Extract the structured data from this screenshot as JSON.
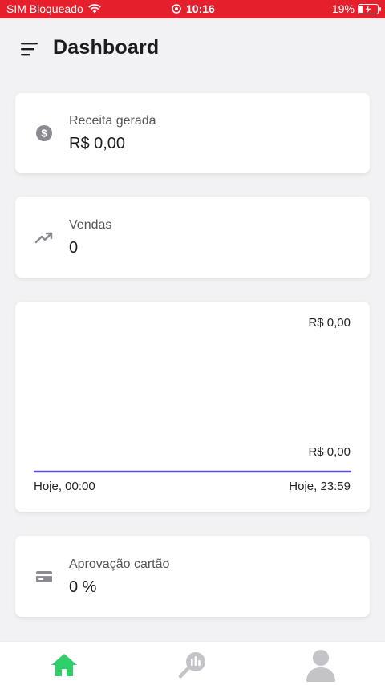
{
  "status_bar": {
    "carrier": "SIM Bloqueado",
    "time": "10:16",
    "battery": "19%",
    "battery_level": 0.19,
    "color": "#e5202c"
  },
  "header": {
    "title": "Dashboard",
    "menu_icon": "menu-icon"
  },
  "metrics": {
    "revenue": {
      "label": "Receita gerada",
      "value": "R$ 0,00",
      "icon": "dollar-circle-icon"
    },
    "sales": {
      "label": "Vendas",
      "value": "0",
      "icon": "trending-up-icon"
    },
    "approval": {
      "label": "Aprovação cartão",
      "value": "0 %",
      "icon": "credit-card-icon"
    }
  },
  "chart_data": {
    "type": "line",
    "x": [
      "Hoje, 00:00",
      "Hoje, 23:59"
    ],
    "series": [
      {
        "values": [
          0,
          0
        ],
        "color": "#5b4fcf"
      }
    ],
    "y_tick_labels": [
      "R$ 0,00",
      "R$ 0,00"
    ],
    "x_tick_labels": [
      "Hoje, 00:00",
      "Hoje, 23:59"
    ],
    "grid": false
  },
  "bottom_nav": {
    "items": [
      {
        "icon": "home-icon",
        "active": true
      },
      {
        "icon": "analytics-icon",
        "active": false
      },
      {
        "icon": "user-icon",
        "active": false
      }
    ],
    "active_color": "#2fcf6a",
    "inactive_color": "#c4c4c8"
  }
}
